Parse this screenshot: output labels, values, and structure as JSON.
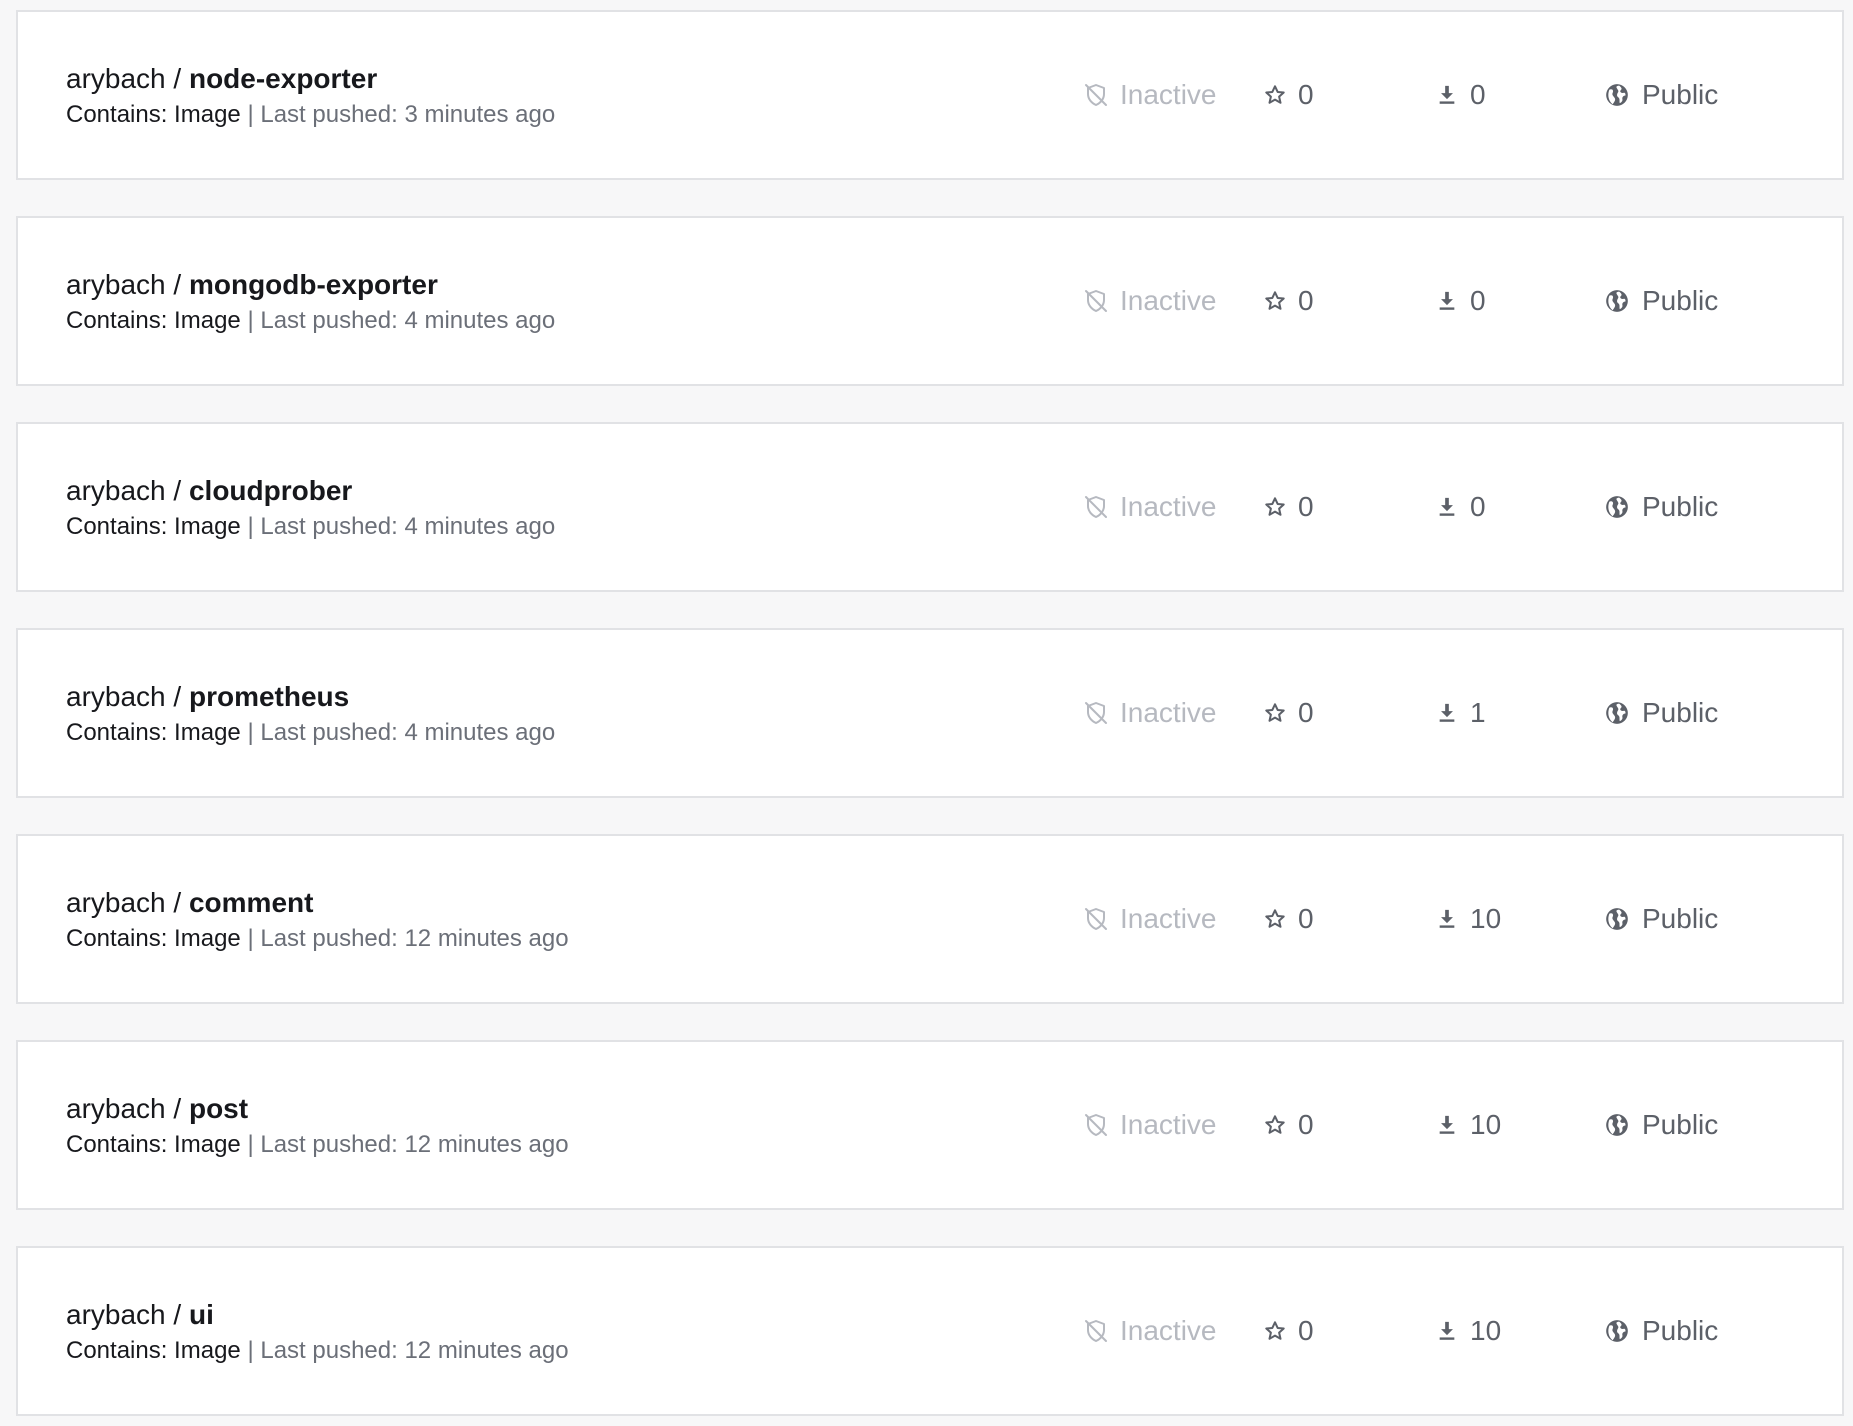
{
  "repositories": [
    {
      "namespace": "arybach",
      "separator": "/",
      "name": "node-exporter",
      "contains_label": "Contains: Image",
      "divider": "|",
      "last_pushed": "Last pushed: 3 minutes ago",
      "status": "Inactive",
      "stars": "0",
      "pulls": "0",
      "visibility": "Public"
    },
    {
      "namespace": "arybach",
      "separator": "/",
      "name": "mongodb-exporter",
      "contains_label": "Contains: Image",
      "divider": "|",
      "last_pushed": "Last pushed: 4 minutes ago",
      "status": "Inactive",
      "stars": "0",
      "pulls": "0",
      "visibility": "Public"
    },
    {
      "namespace": "arybach",
      "separator": "/",
      "name": "cloudprober",
      "contains_label": "Contains: Image",
      "divider": "|",
      "last_pushed": "Last pushed: 4 minutes ago",
      "status": "Inactive",
      "stars": "0",
      "pulls": "0",
      "visibility": "Public"
    },
    {
      "namespace": "arybach",
      "separator": "/",
      "name": "prometheus",
      "contains_label": "Contains: Image",
      "divider": "|",
      "last_pushed": "Last pushed: 4 minutes ago",
      "status": "Inactive",
      "stars": "0",
      "pulls": "1",
      "visibility": "Public"
    },
    {
      "namespace": "arybach",
      "separator": "/",
      "name": "comment",
      "contains_label": "Contains: Image",
      "divider": "|",
      "last_pushed": "Last pushed: 12 minutes ago",
      "status": "Inactive",
      "stars": "0",
      "pulls": "10",
      "visibility": "Public"
    },
    {
      "namespace": "arybach",
      "separator": "/",
      "name": "post",
      "contains_label": "Contains: Image",
      "divider": "|",
      "last_pushed": "Last pushed: 12 minutes ago",
      "status": "Inactive",
      "stars": "0",
      "pulls": "10",
      "visibility": "Public"
    },
    {
      "namespace": "arybach",
      "separator": "/",
      "name": "ui",
      "contains_label": "Contains: Image",
      "divider": "|",
      "last_pushed": "Last pushed: 12 minutes ago",
      "status": "Inactive",
      "stars": "0",
      "pulls": "10",
      "visibility": "Public"
    }
  ],
  "icons": {
    "status": "shield-off-icon",
    "stars": "star-icon",
    "pulls": "download-icon",
    "visibility": "globe-icon"
  },
  "colors": {
    "page_background": "#f7f7f8",
    "card_background": "#ffffff",
    "card_border": "#e1e2e5",
    "primary_text": "#17181c",
    "secondary_text": "#6b6f78",
    "inactive_text": "#b6b9c0",
    "stat_text": "#5c6068"
  }
}
